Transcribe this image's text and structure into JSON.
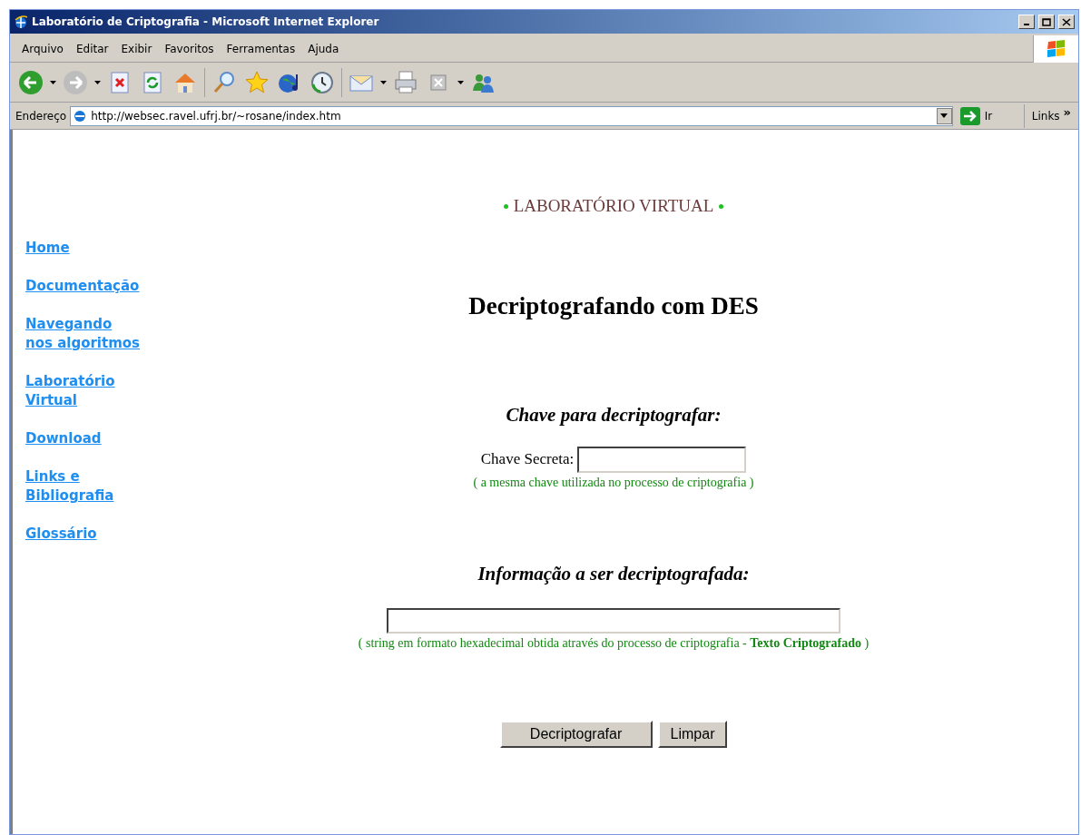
{
  "window": {
    "title": "Laboratório de Criptografia - Microsoft Internet Explorer"
  },
  "menu": [
    "Arquivo",
    "Editar",
    "Exibir",
    "Favoritos",
    "Ferramentas",
    "Ajuda"
  ],
  "address_bar": {
    "label": "Endereço",
    "value": "http://websec.ravel.ufrj.br/~rosane/index.htm",
    "go": "Ir",
    "links": "Links",
    "more": "»"
  },
  "page": {
    "banner": "LABORATÓRIO VIRTUAL",
    "sidebar": [
      {
        "label": "Home"
      },
      {
        "label": "Documentação"
      },
      {
        "label": "Navegando nos algoritmos"
      },
      {
        "label": "Laboratório Virtual"
      },
      {
        "label": "Download"
      },
      {
        "label": "Links e Bibliografia"
      },
      {
        "label": "Glossário"
      }
    ],
    "heading": "Decriptografando com DES",
    "key_section": {
      "title": "Chave para decriptografar:",
      "label": "Chave Secreta:",
      "hint": "( a mesma chave utilizada no processo de criptografia )"
    },
    "data_section": {
      "title": "Informação a ser decriptografada:",
      "hint": "( string em formato hexadecimal obtida através do processo de criptografia - **Texto Criptografado** )"
    },
    "buttons": [
      "Decriptografar",
      "Limpar"
    ]
  }
}
